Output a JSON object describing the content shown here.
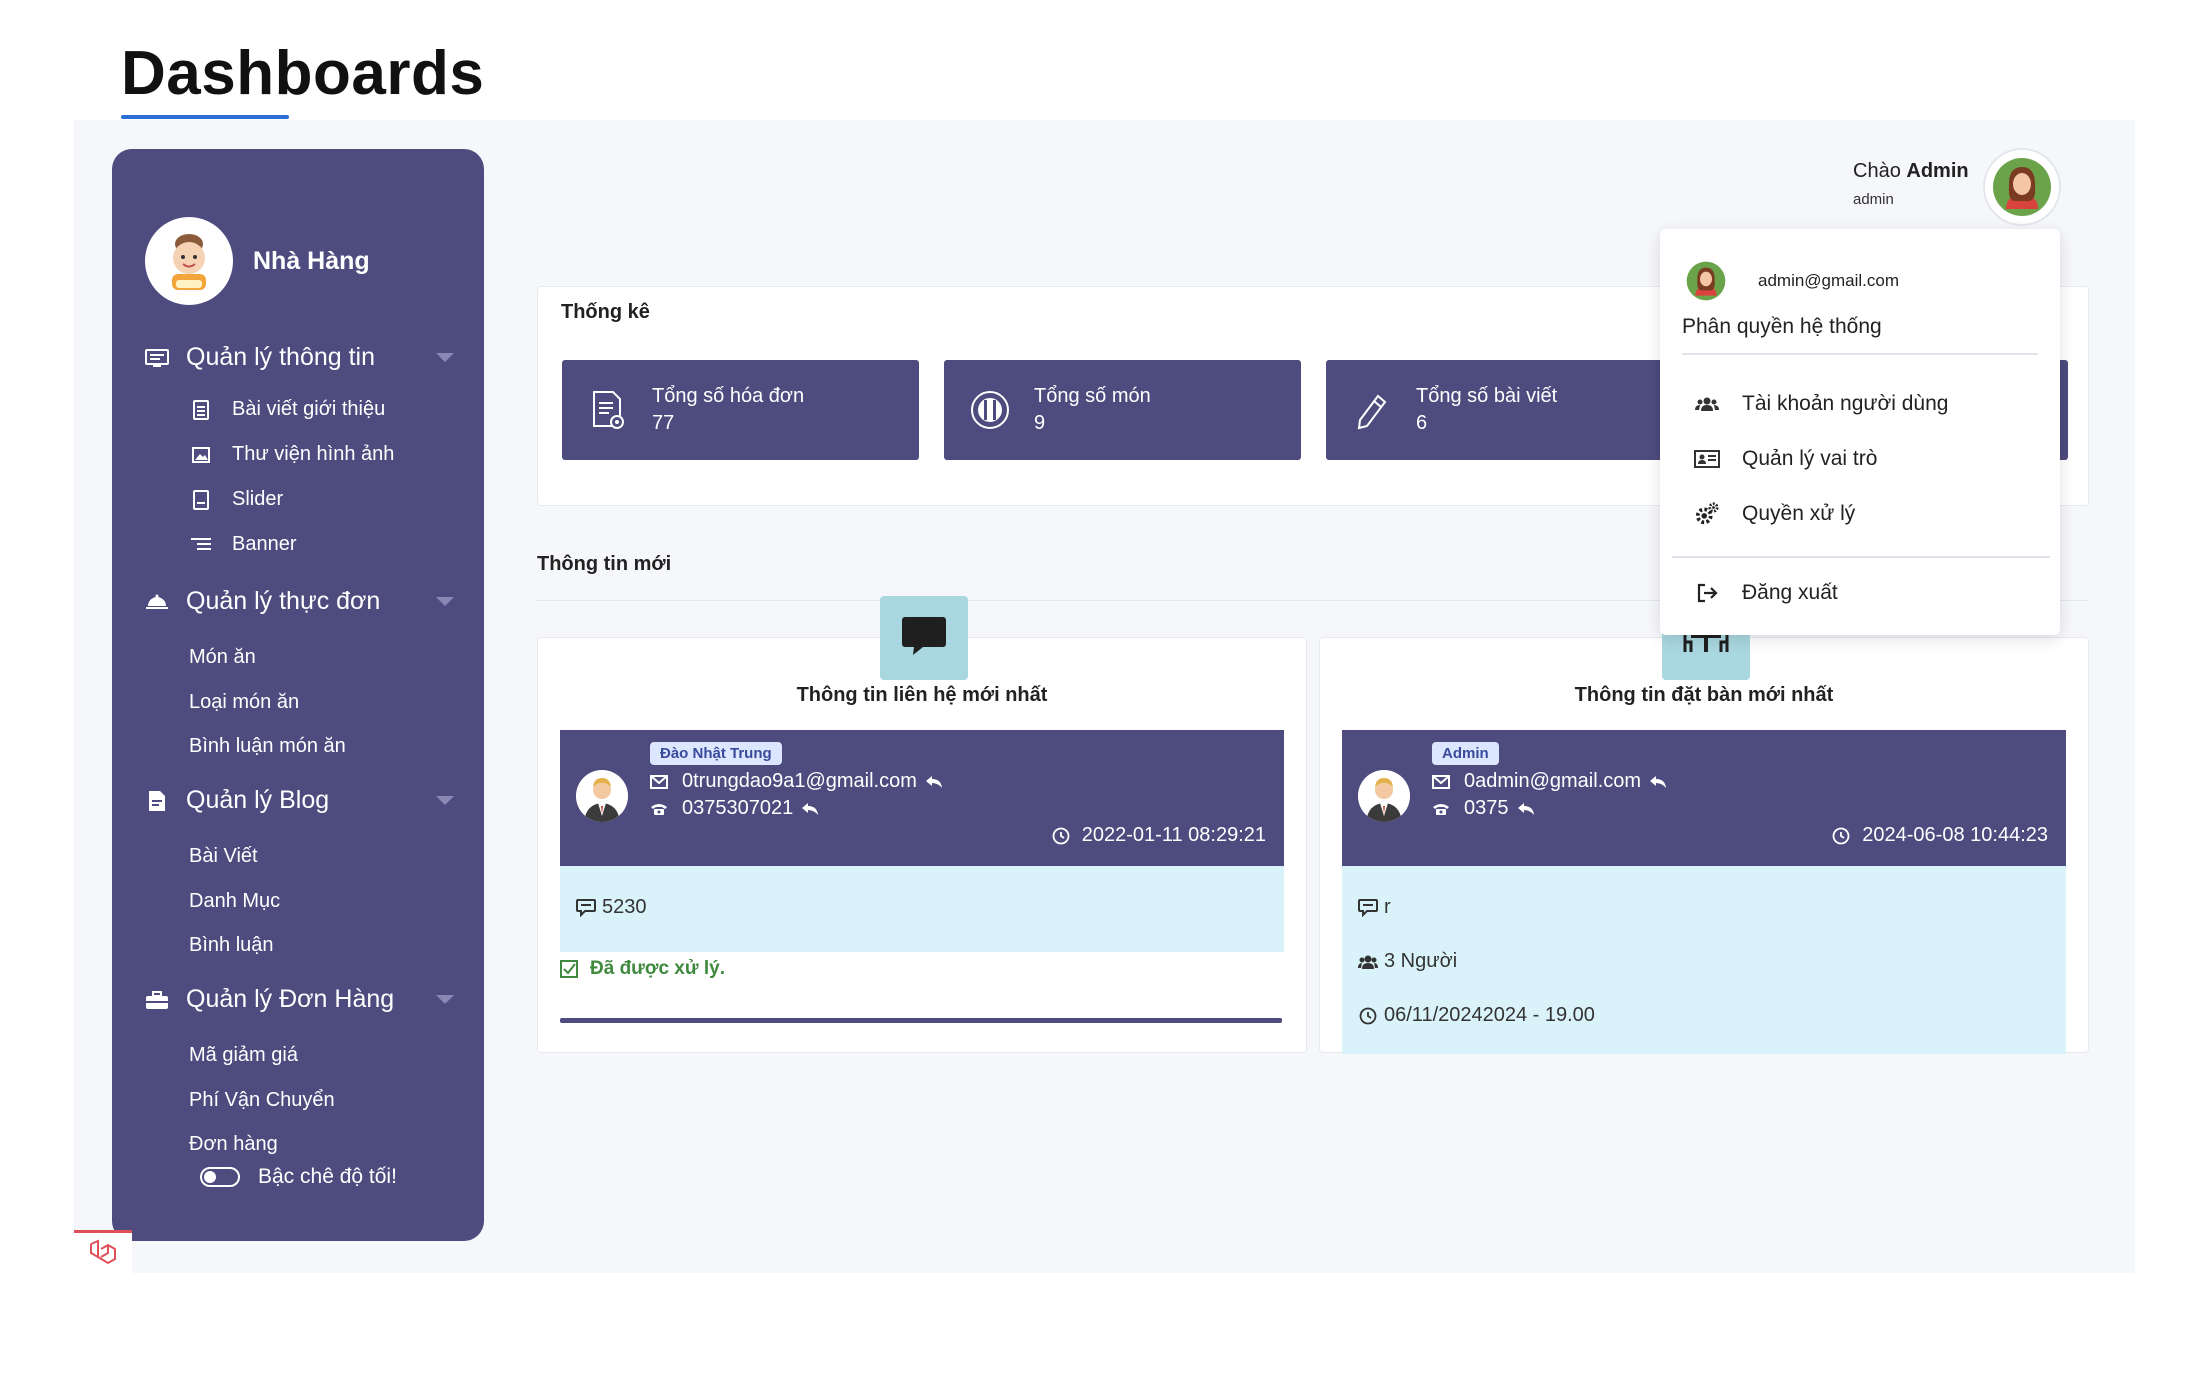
{
  "page": {
    "title": "Dashboards"
  },
  "sidebar": {
    "brand_name": "Nhà Hàng",
    "groups": [
      {
        "label": "Quản lý thông tin",
        "icon": "monitor-icon",
        "items": [
          {
            "label": "Bài viết giới thiệu",
            "icon": "document-icon"
          },
          {
            "label": "Thư viện hình ảnh",
            "icon": "image-icon"
          },
          {
            "label": "Slider",
            "icon": "slider-icon"
          },
          {
            "label": "Banner",
            "icon": "banner-icon"
          }
        ]
      },
      {
        "label": "Quản lý thực đơn",
        "icon": "food-tray-icon",
        "items": [
          {
            "label": "Món ăn"
          },
          {
            "label": "Loại món ăn"
          },
          {
            "label": "Bình luận món ăn"
          }
        ]
      },
      {
        "label": "Quản lý Blog",
        "icon": "blog-icon",
        "items": [
          {
            "label": "Bài Viết"
          },
          {
            "label": "Danh Mục"
          },
          {
            "label": "Bình luận"
          }
        ]
      },
      {
        "label": "Quản lý Đơn Hàng",
        "icon": "briefcase-icon",
        "items": [
          {
            "label": "Mã giảm giá"
          },
          {
            "label": "Phí Vận Chuyển"
          },
          {
            "label": "Đơn hàng"
          }
        ]
      }
    ],
    "dark_mode_label": "Bậc chê độ tối!"
  },
  "header": {
    "greeting_prefix": "Chào",
    "user_name": "Admin",
    "user_role": "admin"
  },
  "stats": {
    "title": "Thống kê",
    "cards": [
      {
        "label": "Tổng số hóa đơn",
        "value": "77",
        "icon": "invoice-icon"
      },
      {
        "label": "Tổng số món",
        "value": "9",
        "icon": "dish-icon"
      },
      {
        "label": "Tổng số bài viết",
        "value": "6",
        "icon": "pencil-icon"
      }
    ]
  },
  "latest": {
    "title": "Thông tin mới",
    "contact": {
      "title": "Thông tin liên hệ mới nhất",
      "name": "Đào Nhật Trung",
      "email": "0trungdao9a1@gmail.com",
      "phone": "0375307021",
      "time": "2022-01-11 08:29:21",
      "message": "5230",
      "status": "Đã được xử lý."
    },
    "booking": {
      "title": "Thông tin đặt bàn mới nhất",
      "name": "Admin",
      "email": "0admin@gmail.com",
      "phone": "0375",
      "time": "2024-06-08 10:44:23",
      "note": "r",
      "people": "3 Người",
      "datetime": "06/11/20242024 - 19.00"
    }
  },
  "dropdown": {
    "email": "admin@gmail.com",
    "heading": "Phân quyền hệ thống",
    "items": [
      {
        "label": "Tài khoản người dùng",
        "icon": "users-icon"
      },
      {
        "label": "Quản lý vai trò",
        "icon": "id-card-icon"
      },
      {
        "label": "Quyền xử lý",
        "icon": "gears-icon"
      }
    ],
    "logout": "Đăng xuất"
  },
  "colors": {
    "sidebar": "#4e4b7e",
    "accent": "#2b6fd6",
    "badge": "#a9d7e0",
    "body_bg": "#daf3fa",
    "success": "#3f8a3f"
  }
}
